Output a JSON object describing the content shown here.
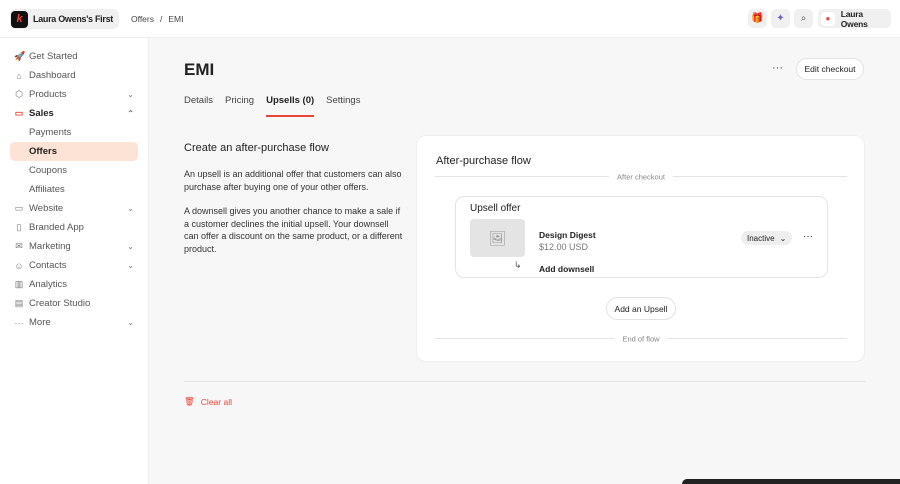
{
  "brand": {
    "name": "Laura Owens's First",
    "logo_letter": "k"
  },
  "breadcrumb": [
    "Offers",
    "/",
    "EMI"
  ],
  "topbar": {
    "user": "Laura Owens",
    "icons": [
      "gift-icon",
      "magic-wand-icon",
      "search-icon",
      "user-icon"
    ]
  },
  "sidebar": {
    "items": [
      {
        "label": "Get Started",
        "icon": "rocket-icon",
        "glyph": "🚀"
      },
      {
        "label": "Dashboard",
        "icon": "home-icon",
        "glyph": "⌂"
      },
      {
        "label": "Products",
        "icon": "box-icon",
        "glyph": "⬡",
        "chev": "⌄"
      },
      {
        "label": "Sales",
        "icon": "card-icon",
        "glyph": "▭",
        "chev": "⌃",
        "open": true
      },
      {
        "label": "Payments",
        "sub": true
      },
      {
        "label": "Offers",
        "sub": true,
        "active": true
      },
      {
        "label": "Coupons",
        "sub": true
      },
      {
        "label": "Affiliates",
        "sub": true
      },
      {
        "label": "Website",
        "icon": "monitor-icon",
        "glyph": "▭",
        "chev": "⌄"
      },
      {
        "label": "Branded App",
        "icon": "phone-icon",
        "glyph": "▯"
      },
      {
        "label": "Marketing",
        "icon": "mail-icon",
        "glyph": "✉",
        "chev": "⌄"
      },
      {
        "label": "Contacts",
        "icon": "users-icon",
        "glyph": "☺",
        "chev": "⌄"
      },
      {
        "label": "Analytics",
        "icon": "chart-icon",
        "glyph": "▥"
      },
      {
        "label": "Creator Studio",
        "icon": "calendar-icon",
        "glyph": "▤"
      },
      {
        "label": "More",
        "icon": "dots-icon",
        "glyph": "···",
        "chev": "⌄"
      }
    ]
  },
  "page": {
    "title": "EMI",
    "edit_checkout": "Edit checkout",
    "more": "···",
    "tabs": [
      {
        "label": "Details"
      },
      {
        "label": "Pricing"
      },
      {
        "label": "Upsells (0)",
        "active": true
      },
      {
        "label": "Settings"
      }
    ]
  },
  "info": {
    "heading": "Create an after-purchase flow",
    "p1": "An upsell is an additional offer that customers can also purchase after buying one of your other offers.",
    "p2": "A downsell gives you another chance to make a sale if a customer declines the initial upsell. Your downsell can offer a discount on the same product, or a different product."
  },
  "flow": {
    "title": "After-purchase flow",
    "after_checkout": "After checkout",
    "end": "End of flow",
    "add_upsell": "Add an Upsell",
    "upsell": {
      "title": "Upsell offer",
      "product": "Design Digest",
      "price": "$12.00 USD",
      "status": "Inactive",
      "add_downsell": "Add downsell"
    }
  },
  "clear_all": "Clear all",
  "colors": {
    "accent": "#e8463a",
    "active_bg": "#fde3d6"
  }
}
